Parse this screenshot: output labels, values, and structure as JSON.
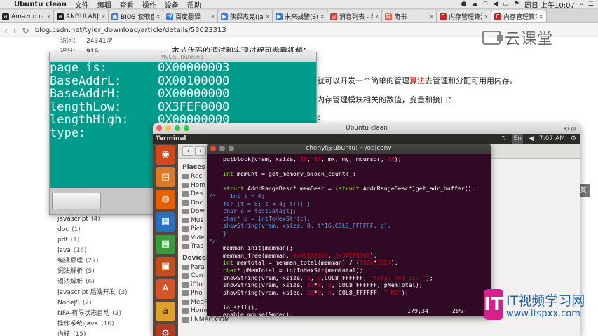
{
  "menubar": {
    "app": "Ubuntu clean",
    "menus": [
      "文件",
      "编辑",
      "查看",
      "操作",
      "设备",
      "帮助"
    ],
    "time": "周日 上午10:07"
  },
  "tabs": [
    {
      "label": "Amazon.com",
      "favicon": "a",
      "color": "#222222"
    },
    {
      "label": "ANGULARJS",
      "favicon": "a",
      "color": "#222222"
    },
    {
      "label": "BIOS 读软盘_IDE",
      "favicon": "▣",
      "color": "#3a7bd5"
    },
    {
      "label": "百度翻译",
      "favicon": "译",
      "color": "#3a7bd5"
    },
    {
      "label": "侠探杰克(Jack",
      "favicon": "▶",
      "color": "#3a7bd5"
    },
    {
      "label": "未来战警(Surr",
      "favicon": "▶",
      "color": "#3a7bd5"
    },
    {
      "label": "消息列表 - 网易",
      "favicon": "◎",
      "color": "#d33"
    },
    {
      "label": "简书",
      "favicon": "简",
      "color": "#e0604a"
    },
    {
      "label": "内存管理算法",
      "favicon": "C",
      "color": "#c22"
    },
    {
      "label": "内存管理算法",
      "favicon": "C",
      "color": "#c22"
    }
  ],
  "address": {
    "url": "blog.csdn.net/tyier_download/article/details/53023313"
  },
  "page": {
    "stat1_label": "访问：",
    "stat1_value": "24341次",
    "stat2_label": "积分：",
    "stat2_value": "919",
    "heading": "本节代码的调试和实现过程可参看视频：",
    "line1_pre": "就可以开发一个简单的管理",
    "line1_red": "算法",
    "line1_post": "去管理和分配可用用内存。",
    "line2": "内存管理模块相关的数值，变量和接口：",
    "six": "6",
    "reply": "复"
  },
  "tags": [
    {
      "name": "javascript",
      "count": "(4)"
    },
    {
      "name": "doc",
      "count": "(1)"
    },
    {
      "name": "pdf",
      "count": "(1)"
    },
    {
      "name": "java",
      "count": "(16)"
    },
    {
      "name": "编译原理",
      "count": "(27)"
    },
    {
      "name": "词法解析",
      "count": "(5)"
    },
    {
      "name": "语法解析",
      "count": "(6)"
    },
    {
      "name": "javascript 后端开发",
      "count": "(3)"
    },
    {
      "name": "NodeJS",
      "count": "(2)"
    },
    {
      "name": "NFA-有限状态自动",
      "count": "(2)"
    },
    {
      "name": "操作系统-java",
      "count": "(16)"
    },
    {
      "name": "内核",
      "count": "(15)"
    }
  ],
  "brand1": "云课堂",
  "brand2": {
    "badge": "IT",
    "cn": "IT视频学习网",
    "en": "www.itspxx.com"
  },
  "myos": {
    "title": "MyOS [Running]",
    "rows": [
      {
        "label": "page is:",
        "value": "0X00000003"
      },
      {
        "label": "BaseAddrL:",
        "value": "0X00100000"
      },
      {
        "label": "BaseAddrH:",
        "value": "0X00000000"
      },
      {
        "label": "lengthLow:",
        "value": "0X3FEF0000"
      },
      {
        "label": "lengthHigh:",
        "value": "0X00000000"
      },
      {
        "label": "type:",
        "value": "0X00000001"
      }
    ]
  },
  "ubuntu": {
    "title": "Ubuntu clean",
    "topbar_title": "Terminal",
    "indicator_lang": "En",
    "indicator_time": "7:07 AM"
  },
  "files": {
    "places_header": "Places",
    "places": [
      "Rec",
      "Hom",
      "Des",
      "Doc",
      "Dow",
      "Mus",
      "Pict",
      "Vide",
      "Tras"
    ],
    "devices_header": "Devices",
    "devices": [
      "Para",
      "Con",
      "iClo",
      "Pho",
      "MedR",
      "Home",
      "LNMAC.COM"
    ]
  },
  "terminal": {
    "title": "chenyi@ubuntu: ~/objconv",
    "status_pos": "179,34",
    "status_pct": "28%"
  }
}
